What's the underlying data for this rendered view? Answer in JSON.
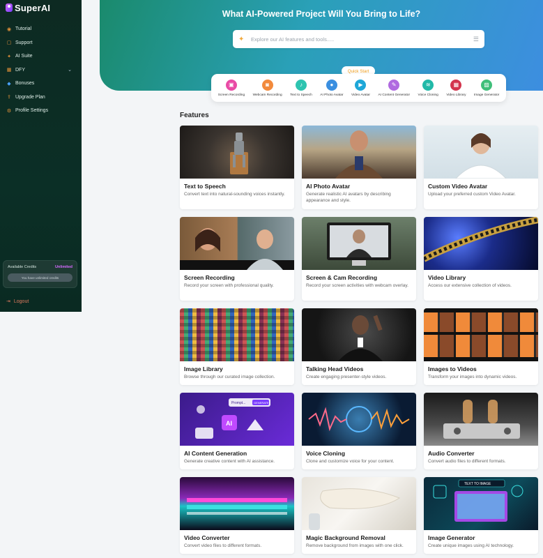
{
  "brand": {
    "name": "SuperAI"
  },
  "sidebar": {
    "items": [
      {
        "label": "Tutorial",
        "icon": "play-circle-icon"
      },
      {
        "label": "Support",
        "icon": "chat-icon"
      },
      {
        "label": "AI Suite",
        "icon": "sparkle-icon"
      },
      {
        "label": "DFY",
        "icon": "grid-icon"
      },
      {
        "label": "Bonuses",
        "icon": "gift-icon"
      },
      {
        "label": "Upgrade Plan",
        "icon": "upgrade-icon"
      },
      {
        "label": "Profile Settings",
        "icon": "gear-icon"
      }
    ],
    "credits": {
      "label": "Available Credits",
      "value": "Unlimited",
      "note": "You have unlimited credits"
    },
    "logout": "Logout"
  },
  "hero": {
    "title": "What AI-Powered Project Will You Bring to Life?",
    "search_placeholder": "Explore our AI features and tools....."
  },
  "quick_start": {
    "badge": "Quick Start",
    "items": [
      {
        "label": "Screen Recording",
        "color": "#e94ba6"
      },
      {
        "label": "Webcam Recording",
        "color": "#f28a3c"
      },
      {
        "label": "Text to Speech",
        "color": "#2ec4b0"
      },
      {
        "label": "AI Photo Avatar",
        "color": "#3b8fe0"
      },
      {
        "label": "Video Avatar",
        "color": "#1ea7d8"
      },
      {
        "label": "AI Content Generator",
        "color": "#b06ae0"
      },
      {
        "label": "Voice Cloning",
        "color": "#21b9a8"
      },
      {
        "label": "Video Library",
        "color": "#d3344d"
      },
      {
        "label": "Image Generator",
        "color": "#3fbf7a"
      }
    ]
  },
  "features": {
    "title": "Features",
    "cards": [
      {
        "title": "Text to Speech",
        "desc": "Convert text into natural-sounding voices instantly."
      },
      {
        "title": "AI Photo Avatar",
        "desc": "Generate realistic AI avatars by describing appearance and style."
      },
      {
        "title": "Custom Video Avatar",
        "desc": "Upload your preferred custom Video Avatar."
      },
      {
        "title": "Screen Recording",
        "desc": "Record your screen with professional quality."
      },
      {
        "title": "Screen & Cam Recording",
        "desc": "Record your screen activities with webcam overlay."
      },
      {
        "title": "Video Library",
        "desc": "Access our extensive collection of videos."
      },
      {
        "title": "Image Library",
        "desc": "Browse through our curated image collection."
      },
      {
        "title": "Talking Head Videos",
        "desc": "Create engaging presenter-style videos."
      },
      {
        "title": "Images to Videos",
        "desc": "Transform your images into dynamic videos."
      },
      {
        "title": "AI Content Generation",
        "desc": "Generate creative content with AI assistance."
      },
      {
        "title": "Voice Cloning",
        "desc": "Clone and customize voice for your content."
      },
      {
        "title": "Audio Converter",
        "desc": "Convert audio files to different formats."
      },
      {
        "title": "Video Converter",
        "desc": "Convert video files to different formats."
      },
      {
        "title": "Magic Background Removal",
        "desc": "Remove background from images with one click."
      },
      {
        "title": "Image Generator",
        "desc": "Create unique images using AI technology."
      }
    ],
    "thumb_text": {
      "prompt": "Prompt...",
      "generate": "GENERATE",
      "ai": "AI",
      "text_to_image": "TEXT TO IMAGE"
    }
  }
}
